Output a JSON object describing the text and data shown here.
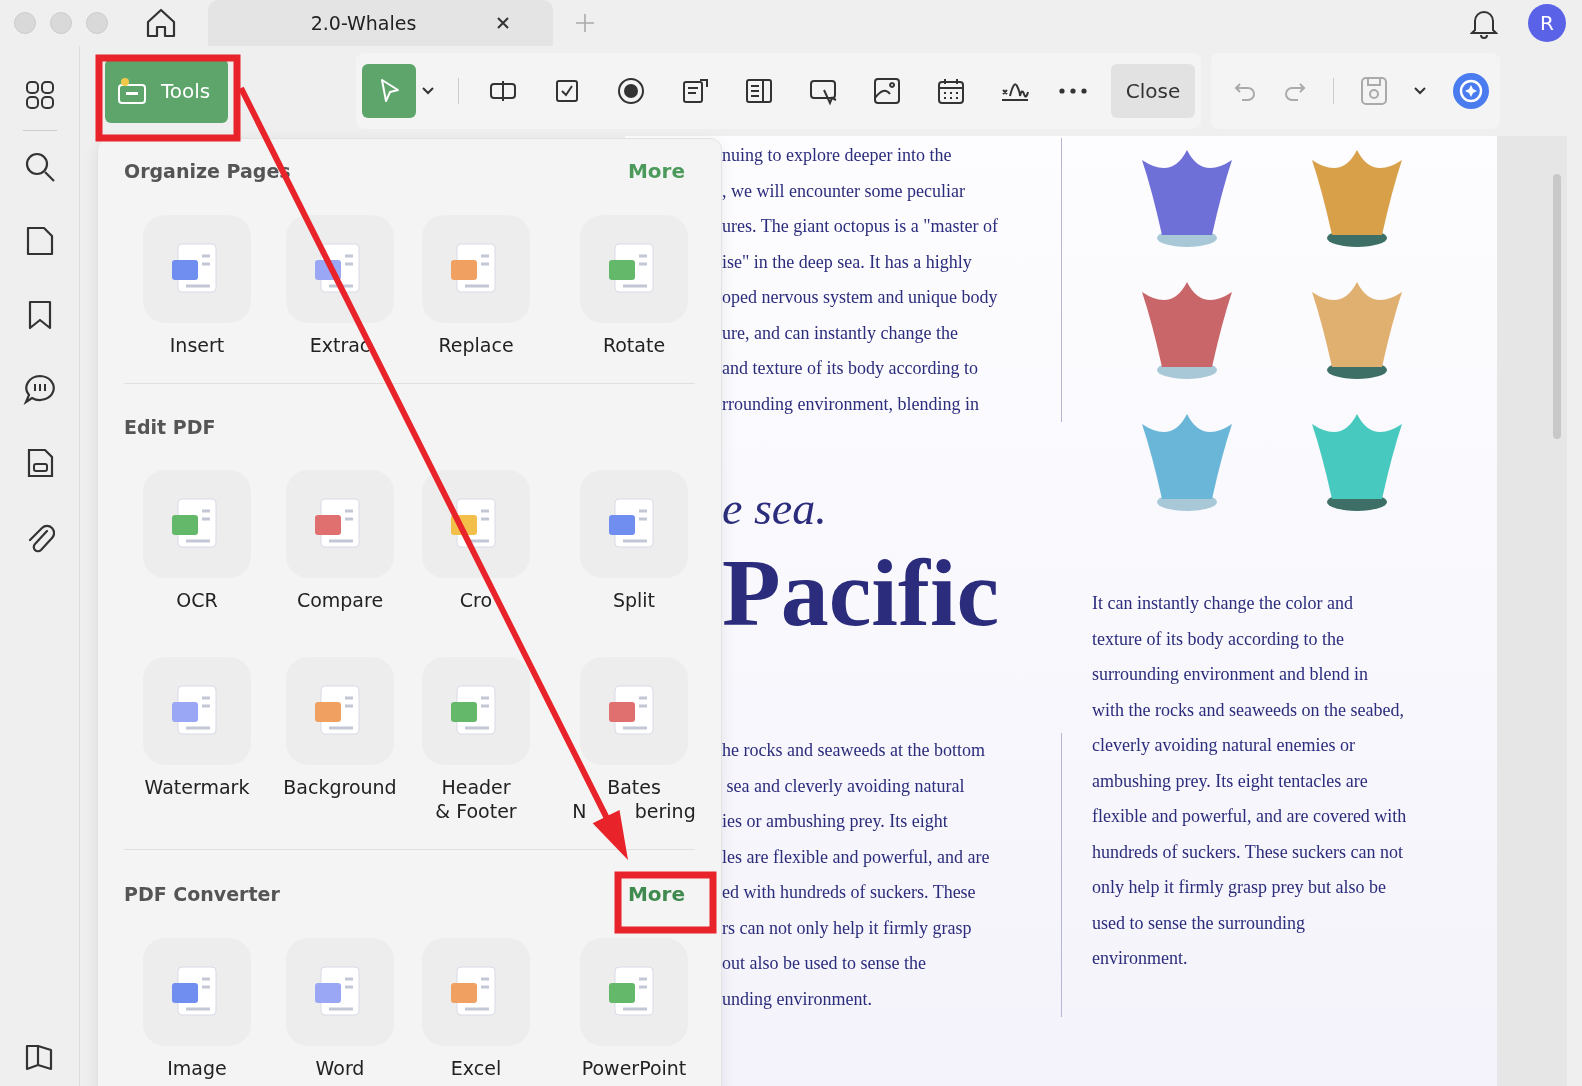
{
  "tab": {
    "title": "2.0-Whales"
  },
  "avatar": {
    "initial": "R"
  },
  "tools_button": {
    "label": "Tools",
    "selected": true
  },
  "form_tools": [
    {
      "selected": true
    },
    {
      "selected": false
    },
    {
      "selected": false
    },
    {
      "selected": false
    },
    {
      "selected": false
    },
    {
      "selected": false
    },
    {
      "selected": false
    },
    {
      "selected": false
    },
    {
      "selected": false
    },
    {
      "selected": false
    }
  ],
  "close_button": {
    "label": "Close"
  },
  "panel": {
    "sections": [
      {
        "title": "Organize Pages",
        "more": "More",
        "highlighted": false,
        "items": [
          "Insert",
          "Extrac",
          "Replace",
          "Rotate"
        ]
      },
      {
        "title": "Edit PDF",
        "items": [
          "OCR",
          "Compare",
          "Cro",
          "Split",
          "Watermark",
          "Background",
          "Header\n& Footer",
          "Bates\nN        bering"
        ]
      },
      {
        "title": "PDF Converter",
        "more": "More",
        "highlighted": true,
        "items": [
          "Image",
          "Word",
          "Excel",
          "PowerPoint"
        ]
      }
    ]
  },
  "document": {
    "para_top": [
      "nuing to explore deeper into the",
      ", we will encounter some peculiar",
      "ures. The giant octopus is a \"master of",
      "ise\" in the deep sea. It has a highly",
      "oped nervous system and unique body",
      "ure, and can instantly change the",
      "and texture of its body according to",
      "rrounding environment, blending in"
    ],
    "heading_italic": "e sea.",
    "heading_big": "Pacific",
    "para_bottom": [
      "he rocks and seaweeds at the bottom",
      " sea and cleverly avoiding natural",
      "ies or ambushing prey. Its eight",
      "les are flexible and powerful, and are",
      "ed with hundreds of suckers. These",
      "rs can not only help it firmly grasp",
      "out also be used to sense the",
      "unding environment."
    ],
    "para_right": [
      "It can instantly change the color and",
      "texture of its body according to the",
      "surrounding environment and blend in",
      "with the rocks and seaweeds on the seabed,",
      "cleverly avoiding natural enemies or",
      "ambushing prey. Its eight tentacles are",
      "flexible and powerful, and are covered with",
      "hundreds of suckers. These suckers can not",
      "only help it firmly grasp prey but also be",
      "used to sense the surrounding",
      "environment."
    ]
  }
}
